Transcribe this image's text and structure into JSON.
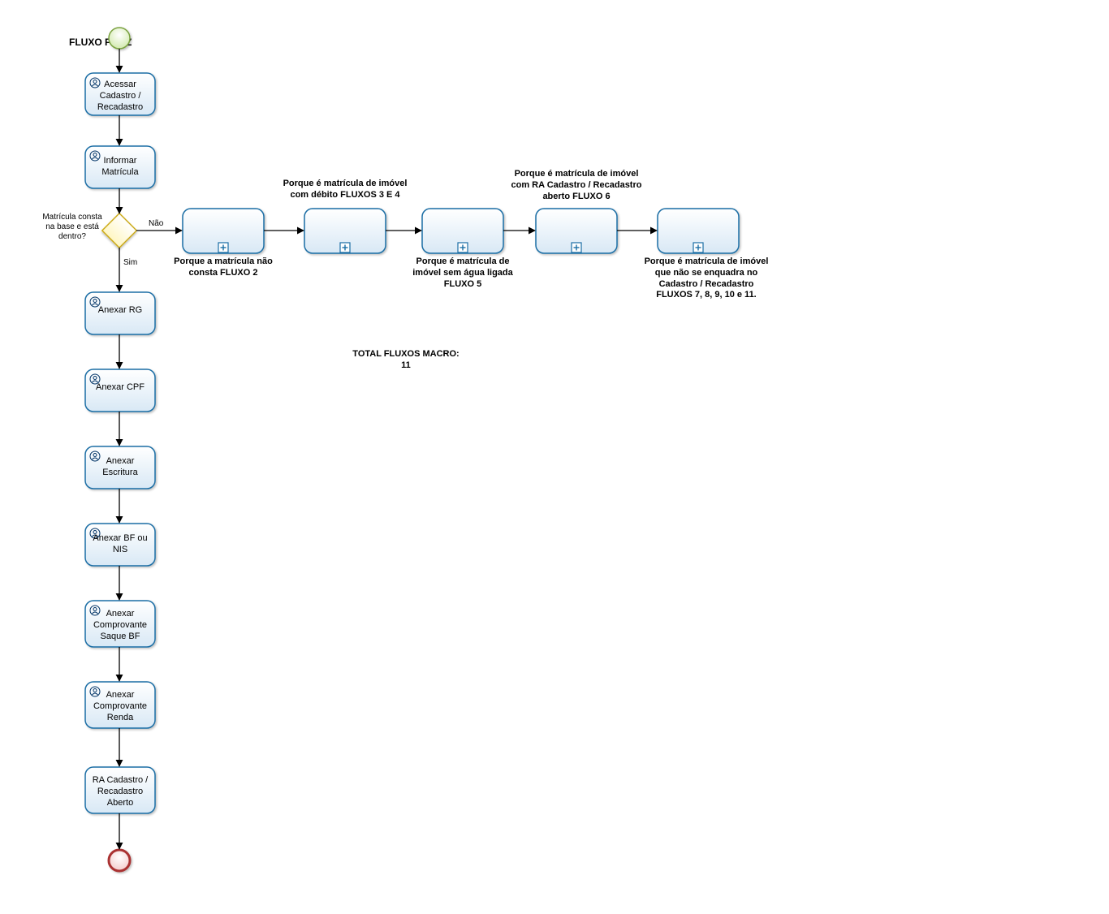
{
  "title": "FLUXO FELIZ",
  "gateway": {
    "label": "Matrícula consta na base e está dentro?",
    "yes": "Sim",
    "no": "Não"
  },
  "tasks": {
    "t1": "Acessar Cadastro / Recadastro",
    "t2": "Informar Matrícula",
    "t3": "Anexar RG",
    "t4": "Anexar CPF",
    "t5": "Anexar Escritura",
    "t6": "Anexar BF ou NIS",
    "t7": "Anexar Comprovante Saque BF",
    "t8": "Anexar Comprovante Renda",
    "t9": "RA Cadastro / Recadastro Aberto"
  },
  "subprocesses": {
    "sp1": "Porque a matrícula não consta  FLUXO 2",
    "sp2": "Porque é matrícula de imóvel com débito FLUXOS 3 E 4",
    "sp3": "Porque é matrícula de imóvel sem água ligada FLUXO 5",
    "sp4": "Porque é matrícula de imóvel com RA Cadastro / Recadastro aberto FLUXO 6",
    "sp5": "Porque é matrícula de imóvel que não se enquadra no Cadastro / Recadastro FLUXOS  7, 8, 9, 10 e 11."
  },
  "note": "TOTAL FLUXOS MACRO: 11"
}
